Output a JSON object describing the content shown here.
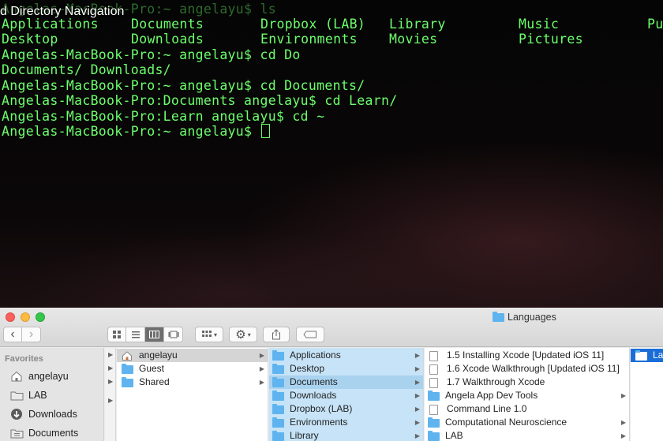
{
  "video": {
    "title": "d Directory Navigation"
  },
  "terminal": {
    "faded_line": "Angelas-MacBook-Pro:~ angelayu$ ls",
    "ls_output": [
      [
        "Applications",
        "Documents",
        "Dropbox (LAB)",
        "Library",
        "Music",
        "Pu"
      ],
      [
        "Desktop",
        "Downloads",
        "Environments",
        "Movies",
        "Pictures",
        ""
      ]
    ],
    "lines": [
      "Angelas-MacBook-Pro:~ angelayu$ cd Do",
      "Documents/ Downloads/",
      "Angelas-MacBook-Pro:~ angelayu$ cd Documents/",
      "Angelas-MacBook-Pro:Documents angelayu$ cd Learn/",
      "Angelas-MacBook-Pro:Learn angelayu$ cd ~",
      "Angelas-MacBook-Pro:~ angelayu$ "
    ]
  },
  "finder": {
    "window_title": "Languages",
    "toolbar": {
      "back": "‹",
      "forward": "›",
      "view_icons": "icon-view-icon",
      "view_list": "list-view-icon",
      "view_columns": "column-view-icon",
      "view_gallery": "gallery-view-icon",
      "arrange": "arrange-icon",
      "action": "gear-icon",
      "share": "share-icon",
      "tags": "tag-icon"
    },
    "sidebar": {
      "heading": "Favorites",
      "items": [
        {
          "label": "angelayu",
          "icon": "home-icon"
        },
        {
          "label": "LAB",
          "icon": "folder-icon"
        },
        {
          "label": "Downloads",
          "icon": "downloads-icon"
        },
        {
          "label": "Documents",
          "icon": "documents-icon"
        }
      ]
    },
    "column1": [
      {
        "label": "angelayu",
        "icon": "home-icon",
        "selected": true
      },
      {
        "label": "Guest",
        "icon": "folder-icon"
      },
      {
        "label": "Shared",
        "icon": "folder-icon"
      }
    ],
    "column2": [
      {
        "label": "Applications"
      },
      {
        "label": "Desktop"
      },
      {
        "label": "Documents",
        "selected": true
      },
      {
        "label": "Downloads"
      },
      {
        "label": "Dropbox (LAB)"
      },
      {
        "label": "Environments"
      },
      {
        "label": "Library"
      }
    ],
    "column3": [
      {
        "label": "1.5 Installing Xcode [Updated iOS 11]",
        "icon": "file-icon"
      },
      {
        "label": "1.6 Xcode Walkthrough [Updated iOS 11]",
        "icon": "file-icon"
      },
      {
        "label": "1.7 Walkthrough Xcode",
        "icon": "file-icon"
      },
      {
        "label": "Angela App Dev Tools",
        "icon": "folder-icon",
        "has_children": true
      },
      {
        "label": "Command Line 1.0",
        "icon": "file-icon"
      },
      {
        "label": "Computational Neuroscience",
        "icon": "folder-icon",
        "has_children": true
      },
      {
        "label": "LAB",
        "icon": "folder-icon",
        "has_children": true
      }
    ],
    "column4": [
      {
        "label": "La",
        "icon": "folder-icon",
        "selected": true
      }
    ]
  }
}
